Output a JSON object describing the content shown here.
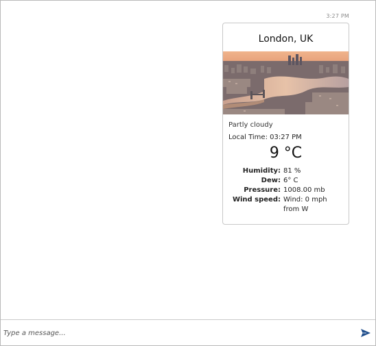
{
  "chat": {
    "timestamp": "3:27 PM"
  },
  "weather_card": {
    "title": "London, UK",
    "image_alt": "London skyline",
    "condition": "Partly cloudy",
    "local_time": "Local Time: 03:27 PM",
    "temperature": "9 °C",
    "facts": [
      {
        "label": "Humidity:",
        "value": "81 %"
      },
      {
        "label": "Dew:",
        "value": "6° C"
      },
      {
        "label": "Pressure:",
        "value": "1008.00 mb"
      },
      {
        "label": "Wind speed:",
        "value": "Wind: 0 mph from W"
      }
    ]
  },
  "composer": {
    "placeholder": "Type a message...",
    "send_icon": "send-icon",
    "accent_color": "#1f4e8c"
  }
}
